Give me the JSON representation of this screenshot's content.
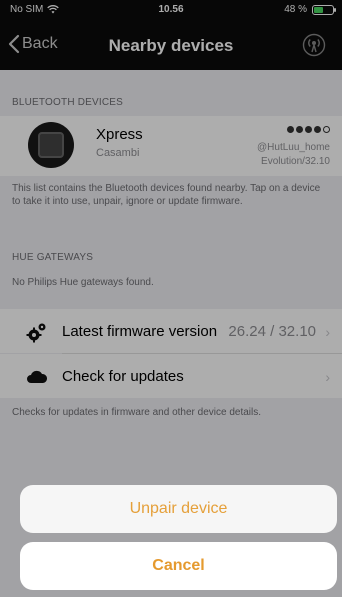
{
  "status_bar": {
    "carrier": "No SIM",
    "time": "10.56",
    "battery_percent": "48 %",
    "battery_level": 0.48
  },
  "nav": {
    "back_label": "Back",
    "title": "Nearby devices",
    "right_icon": "broadcast-icon"
  },
  "bluetooth": {
    "header": "BLUETOOTH DEVICES",
    "device": {
      "name": "Xpress",
      "manufacturer": "Casambi",
      "network": "@HutLuu_home",
      "firmware": "Evolution/32.10",
      "signal_strength": 4,
      "signal_max": 5
    },
    "footer": "This list contains the Bluetooth devices found nearby. Tap on a device to take it into use, unpair, ignore or update firmware."
  },
  "hue": {
    "header": "HUE GATEWAYS",
    "empty_text": "No Philips Hue gateways found."
  },
  "firmware": {
    "latest_label": "Latest firmware version",
    "latest_value": "26.24 / 32.10",
    "check_label": "Check for updates",
    "footer": "Checks for updates in firmware and other device details."
  },
  "action_sheet": {
    "unpair_label": "Unpair device",
    "cancel_label": "Cancel",
    "accent_color": "#e5a03a"
  }
}
